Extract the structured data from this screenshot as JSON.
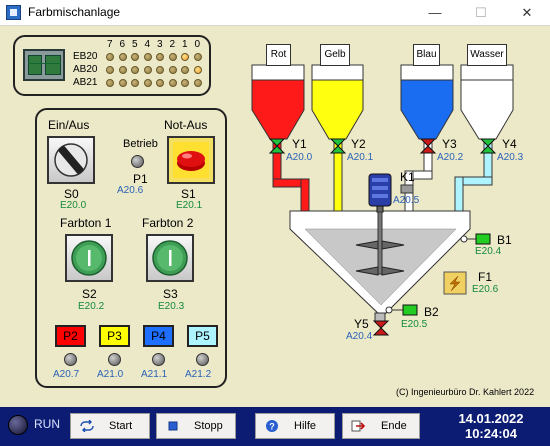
{
  "window": {
    "title": "Farbmischanlage",
    "min_glyph": "—",
    "max_glyph": "☐",
    "close_glyph": "✕"
  },
  "io_panel": {
    "bit_headers": [
      "7",
      "6",
      "5",
      "4",
      "3",
      "2",
      "1",
      "0"
    ],
    "rows": [
      {
        "label": "EB20",
        "states": [
          0,
          0,
          0,
          0,
          0,
          0,
          1,
          0
        ]
      },
      {
        "label": "AB20",
        "states": [
          0,
          0,
          0,
          0,
          0,
          0,
          0,
          1
        ]
      },
      {
        "label": "AB21",
        "states": [
          0,
          0,
          0,
          0,
          0,
          0,
          0,
          0
        ]
      }
    ]
  },
  "control": {
    "ein_aus_label": "Ein/Aus",
    "not_aus_label": "Not-Aus",
    "betrieb_label": "Betrieb",
    "s0": {
      "name": "S0",
      "addr": "E20.0"
    },
    "p1": {
      "name": "P1",
      "addr": "A20.6"
    },
    "s1": {
      "name": "S1",
      "addr": "E20.1"
    },
    "farbton1_label": "Farbton 1",
    "farbton2_label": "Farbton 2",
    "s2": {
      "name": "S2",
      "addr": "E20.2"
    },
    "s3": {
      "name": "S3",
      "addr": "E20.3"
    },
    "color_buttons": [
      {
        "label": "P2",
        "color": "#ff0000",
        "addr": "A20.7"
      },
      {
        "label": "P3",
        "color": "#ffff00",
        "addr": "A21.0"
      },
      {
        "label": "P4",
        "color": "#1e6fff",
        "addr": "A21.1"
      },
      {
        "label": "P5",
        "color": "#aef4ff",
        "addr": "A21.2"
      }
    ]
  },
  "plant": {
    "tanks": [
      {
        "label": "Rot",
        "fill": "#ff1a1a",
        "valve": "Y1",
        "addr": "A20.0"
      },
      {
        "label": "Gelb",
        "fill": "#ffff10",
        "valve": "Y2",
        "addr": "A20.1"
      },
      {
        "label": "Blau",
        "fill": "#1a6cf0",
        "valve": "Y3",
        "addr": "A20.2"
      },
      {
        "label": "Wasser",
        "fill": "#ffffff",
        "valve": "Y4",
        "addr": "A20.3"
      }
    ],
    "k1": {
      "name": "K1",
      "addr": "A20.5"
    },
    "b1": {
      "name": "B1",
      "addr": "E20.4"
    },
    "f1": {
      "name": "F1",
      "addr": "E20.6"
    },
    "b2": {
      "name": "B2",
      "addr": "E20.5"
    },
    "y5": {
      "name": "Y5",
      "addr": "A20.4"
    }
  },
  "copyright": "(C) Ingenieurbüro Dr. Kahlert 2022",
  "status": {
    "run_label": "RUN"
  },
  "toolbar": {
    "start": "Start",
    "stopp": "Stopp",
    "hilfe": "Hilfe",
    "ende": "Ende"
  },
  "datetime": {
    "date": "14.01.2022",
    "time": "10:24:04"
  }
}
